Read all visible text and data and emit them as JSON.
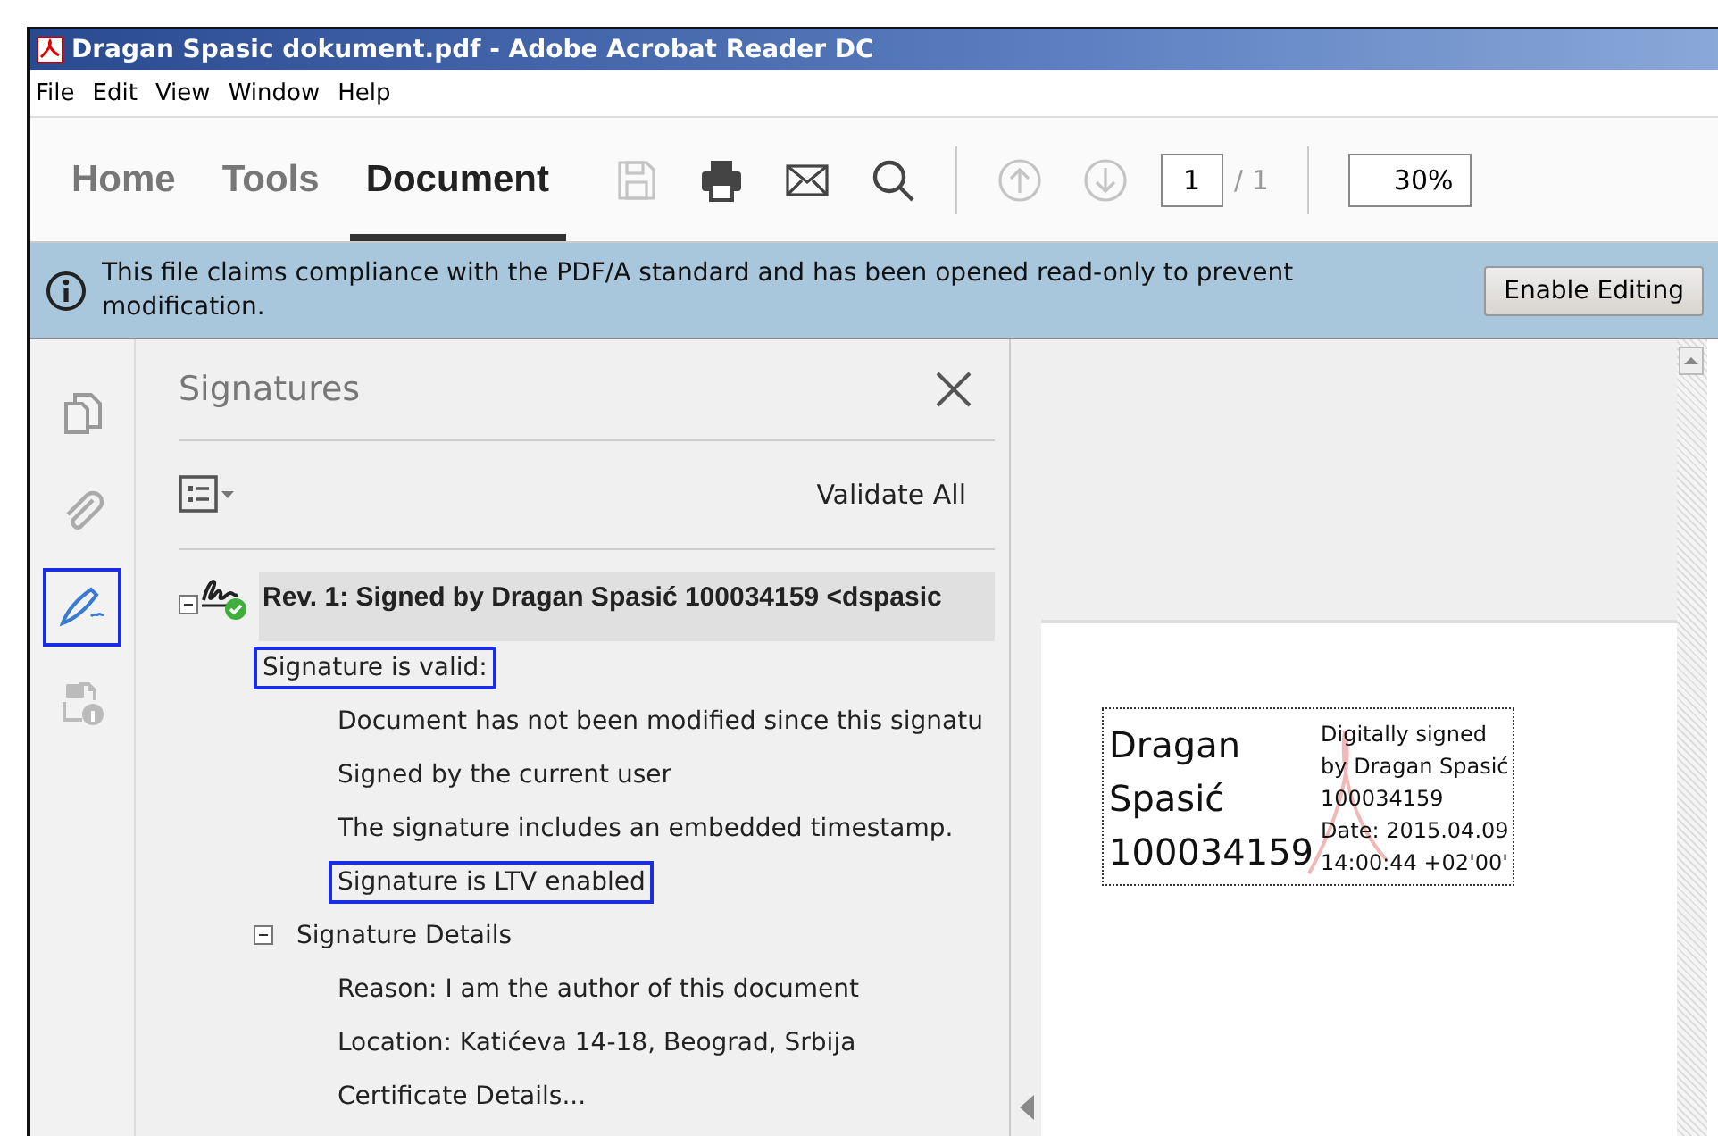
{
  "window": {
    "title": "Dragan Spasic dokument.pdf - Adobe Acrobat Reader DC"
  },
  "menu": [
    "File",
    "Edit",
    "View",
    "Window",
    "Help"
  ],
  "tabs": [
    {
      "label": "Home",
      "selected": false
    },
    {
      "label": "Tools",
      "selected": false
    },
    {
      "label": "Document",
      "selected": true
    }
  ],
  "toolbar": [
    {
      "kind": "save",
      "disabled": true
    },
    {
      "kind": "print",
      "disabled": false
    },
    {
      "kind": "mail",
      "disabled": false
    },
    {
      "kind": "search",
      "disabled": false
    },
    {
      "kind": "up",
      "disabled": true
    },
    {
      "kind": "down",
      "disabled": true
    }
  ],
  "page": {
    "value": "1",
    "total": "/ 1"
  },
  "zoom": {
    "value": "30%"
  },
  "info_bar": {
    "message": "This file claims compliance with the PDF/A standard and has been opened read-only to prevent modification.",
    "button": "Enable Editing"
  },
  "rail": [
    {
      "kind": "pages",
      "highlighted": false
    },
    {
      "kind": "attachment",
      "highlighted": false
    },
    {
      "kind": "signature",
      "highlighted": true
    },
    {
      "kind": "security",
      "highlighted": false
    }
  ],
  "panel": {
    "title": "Signatures",
    "validate_all": "Validate All",
    "tree": [
      {
        "label": "Rev. 1: Signed by Dragan Spasić 100034159 <dspasic",
        "expanded": true,
        "children": [
          {
            "label": "Signature is valid:",
            "highlighted": true,
            "children": [
              {
                "label": "Document has not been modified since this signatu",
                "highlighted": false
              },
              {
                "label": "Signed by the current user",
                "highlighted": false
              },
              {
                "label": "The signature includes an embedded timestamp.",
                "highlighted": false
              },
              {
                "label": "Signature is LTV enabled",
                "highlighted": true
              }
            ]
          },
          {
            "label": "Signature Details",
            "highlighted": false,
            "expanded": true,
            "children": [
              {
                "label": "Reason: I am the author of this document",
                "highlighted": false
              },
              {
                "label": "Location: Katićeva 14-18, Beograd, Srbija",
                "highlighted": false
              },
              {
                "label": "Certificate Details...",
                "highlighted": false
              }
            ]
          }
        ]
      }
    ]
  },
  "stamp": {
    "name_lines": [
      "Dragan",
      "Spasić",
      "100034159"
    ],
    "detail_lines": [
      "Digitally signed",
      "by Dragan Spasić",
      "100034159",
      "Date: 2015.04.09",
      "14:00:44 +02'00'"
    ]
  }
}
